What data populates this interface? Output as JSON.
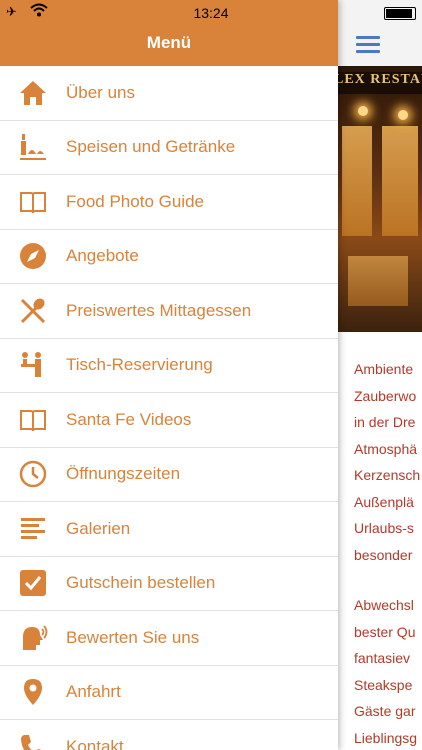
{
  "status_bar": {
    "time": "13:24"
  },
  "header": {
    "title": "Menü"
  },
  "accent_color": "#d9833a",
  "menu_items": [
    {
      "label": "Über uns",
      "icon": "home-icon"
    },
    {
      "label": "Speisen und Getränke",
      "icon": "food-drink-icon"
    },
    {
      "label": "Food Photo Guide",
      "icon": "book-icon"
    },
    {
      "label": "Angebote",
      "icon": "compass-icon"
    },
    {
      "label": "Preiswertes Mittagessen",
      "icon": "fork-spoon-icon"
    },
    {
      "label": "Tisch-Reservierung",
      "icon": "reception-icon"
    },
    {
      "label": "Santa Fe Videos",
      "icon": "book-icon"
    },
    {
      "label": "Öffnungszeiten",
      "icon": "clock-icon"
    },
    {
      "label": "Galerien",
      "icon": "text-lines-icon"
    },
    {
      "label": "Gutschein bestellen",
      "icon": "checkbox-icon"
    },
    {
      "label": "Bewerten Sie uns",
      "icon": "speaking-head-icon"
    },
    {
      "label": "Anfahrt",
      "icon": "location-pin-icon"
    },
    {
      "label": "Kontakt",
      "icon": "phone-icon"
    }
  ],
  "content": {
    "photo_sign": "LEX RESTAU",
    "paragraph1": [
      "Ambiente",
      "Zauberwo",
      "in der Dre",
      "Atmosphä",
      "Kerzensch",
      "Außenplä",
      "Urlaubs-s",
      "besonder"
    ],
    "paragraph2": [
      "Abwechsl",
      "bester Qu",
      "fantasiev",
      "Steakspe",
      "Gäste gar",
      "Lieblingsg"
    ]
  }
}
